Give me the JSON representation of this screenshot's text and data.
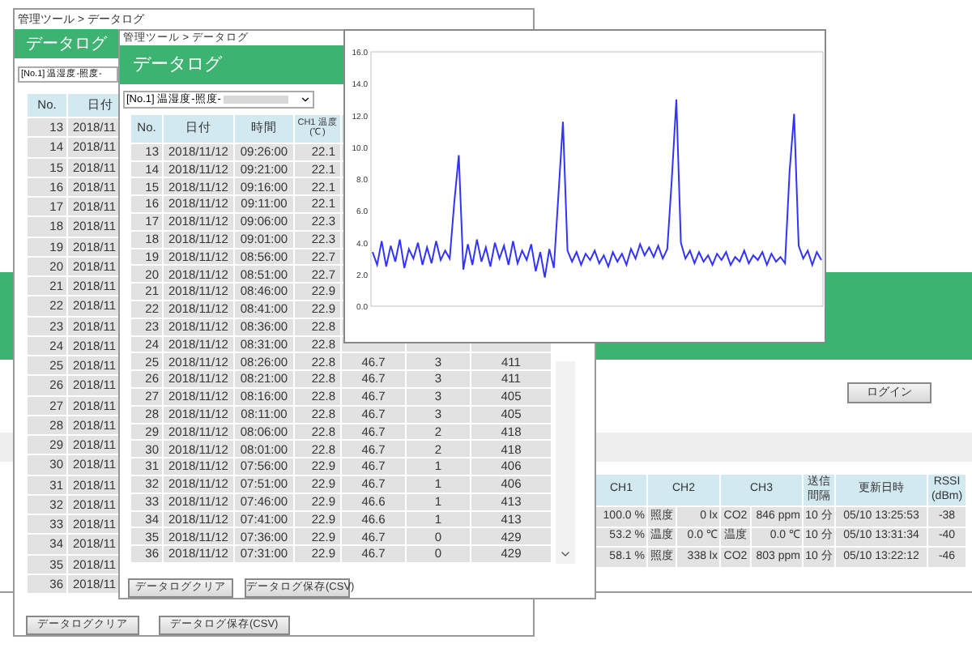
{
  "back_window": {
    "login_button": "ログイン",
    "device_table": {
      "columns": [
        "CH1",
        "CH2",
        "CH3",
        "送信間隔",
        "更新日時",
        "RSSI (dBm)"
      ],
      "rows": [
        {
          "ch1_value": "100.0 %",
          "ch2_label": "照度",
          "ch2_value": "0 lx",
          "ch3_label": "CO2",
          "ch3_value": "846 ppm",
          "interval": "10 分",
          "updated": "05/10 13:25:53",
          "rssi": "-38"
        },
        {
          "ch1_value": "53.2 %",
          "ch2_label": "温度",
          "ch2_value": "0.0 ℃",
          "ch3_label": "温度",
          "ch3_value": "0.0 ℃",
          "interval": "10 分",
          "updated": "05/10 13:31:34",
          "rssi": "-40"
        },
        {
          "ch1_value": "58.1 %",
          "ch2_label": "照度",
          "ch2_value": "338 lx",
          "ch3_label": "CO2",
          "ch3_value": "803 ppm",
          "interval": "10 分",
          "updated": "05/10 13:22:12",
          "rssi": "-46"
        }
      ]
    }
  },
  "window_a": {
    "breadcrumb": "管理ツール > データログ",
    "title": "データログ",
    "device_select": "[No.1] 温湿度-照度-",
    "columns": [
      "No.",
      "日付"
    ],
    "rows": [
      {
        "no": "13",
        "date": "2018/11"
      },
      {
        "no": "14",
        "date": "2018/11"
      },
      {
        "no": "15",
        "date": "2018/11"
      },
      {
        "no": "16",
        "date": "2018/11"
      },
      {
        "no": "17",
        "date": "2018/11"
      },
      {
        "no": "18",
        "date": "2018/11"
      },
      {
        "no": "19",
        "date": "2018/11"
      },
      {
        "no": "20",
        "date": "2018/11"
      },
      {
        "no": "21",
        "date": "2018/11"
      },
      {
        "no": "22",
        "date": "2018/11"
      },
      {
        "no": "23",
        "date": "2018/11"
      },
      {
        "no": "24",
        "date": "2018/11"
      },
      {
        "no": "25",
        "date": "2018/11"
      },
      {
        "no": "26",
        "date": "2018/11"
      },
      {
        "no": "27",
        "date": "2018/11"
      },
      {
        "no": "28",
        "date": "2018/11"
      },
      {
        "no": "29",
        "date": "2018/11"
      },
      {
        "no": "30",
        "date": "2018/11"
      },
      {
        "no": "31",
        "date": "2018/11"
      },
      {
        "no": "32",
        "date": "2018/11"
      },
      {
        "no": "33",
        "date": "2018/11"
      },
      {
        "no": "34",
        "date": "2018/11"
      },
      {
        "no": "35",
        "date": "2018/11"
      },
      {
        "no": "36",
        "date": "2018/11"
      }
    ],
    "buttons": [
      "データログクリア",
      "データログ保存(CSV)"
    ]
  },
  "window_b": {
    "breadcrumb": "管理ツール > データログ",
    "title": "データログ",
    "device_select": "[No.1] 温湿度-照度-",
    "columns": [
      "No.",
      "日付",
      "時間",
      "CH1 温度 (℃)"
    ],
    "rows": [
      {
        "no": "13",
        "date": "2018/11/12",
        "time": "09:26:00",
        "temp": "22.1"
      },
      {
        "no": "14",
        "date": "2018/11/12",
        "time": "09:21:00",
        "temp": "22.1"
      },
      {
        "no": "15",
        "date": "2018/11/12",
        "time": "09:16:00",
        "temp": "22.1"
      },
      {
        "no": "16",
        "date": "2018/11/12",
        "time": "09:11:00",
        "temp": "22.1"
      },
      {
        "no": "17",
        "date": "2018/11/12",
        "time": "09:06:00",
        "temp": "22.3"
      },
      {
        "no": "18",
        "date": "2018/11/12",
        "time": "09:01:00",
        "temp": "22.3"
      },
      {
        "no": "19",
        "date": "2018/11/12",
        "time": "08:56:00",
        "temp": "22.7"
      },
      {
        "no": "20",
        "date": "2018/11/12",
        "time": "08:51:00",
        "temp": "22.7"
      },
      {
        "no": "21",
        "date": "2018/11/12",
        "time": "08:46:00",
        "temp": "22.9"
      },
      {
        "no": "22",
        "date": "2018/11/12",
        "time": "08:41:00",
        "temp": "22.9"
      },
      {
        "no": "23",
        "date": "2018/11/12",
        "time": "08:36:00",
        "temp": "22.8"
      },
      {
        "no": "24",
        "date": "2018/11/12",
        "time": "08:31:00",
        "temp": "22.8"
      },
      {
        "no": "25",
        "date": "2018/11/12",
        "time": "08:26:00",
        "temp": "22.8",
        "humidity": "46.7",
        "lux": "3",
        "co2": "411"
      },
      {
        "no": "26",
        "date": "2018/11/12",
        "time": "08:21:00",
        "temp": "22.8",
        "humidity": "46.7",
        "lux": "3",
        "co2": "411"
      },
      {
        "no": "27",
        "date": "2018/11/12",
        "time": "08:16:00",
        "temp": "22.8",
        "humidity": "46.7",
        "lux": "3",
        "co2": "405"
      },
      {
        "no": "28",
        "date": "2018/11/12",
        "time": "08:11:00",
        "temp": "22.8",
        "humidity": "46.7",
        "lux": "3",
        "co2": "405"
      },
      {
        "no": "29",
        "date": "2018/11/12",
        "time": "08:06:00",
        "temp": "22.8",
        "humidity": "46.7",
        "lux": "2",
        "co2": "418"
      },
      {
        "no": "30",
        "date": "2018/11/12",
        "time": "08:01:00",
        "temp": "22.8",
        "humidity": "46.7",
        "lux": "2",
        "co2": "418"
      },
      {
        "no": "31",
        "date": "2018/11/12",
        "time": "07:56:00",
        "temp": "22.9",
        "humidity": "46.7",
        "lux": "1",
        "co2": "406"
      },
      {
        "no": "32",
        "date": "2018/11/12",
        "time": "07:51:00",
        "temp": "22.9",
        "humidity": "46.7",
        "lux": "1",
        "co2": "406"
      },
      {
        "no": "33",
        "date": "2018/11/12",
        "time": "07:46:00",
        "temp": "22.9",
        "humidity": "46.6",
        "lux": "1",
        "co2": "413"
      },
      {
        "no": "34",
        "date": "2018/11/12",
        "time": "07:41:00",
        "temp": "22.9",
        "humidity": "46.6",
        "lux": "1",
        "co2": "413"
      },
      {
        "no": "35",
        "date": "2018/11/12",
        "time": "07:36:00",
        "temp": "22.9",
        "humidity": "46.7",
        "lux": "0",
        "co2": "429"
      },
      {
        "no": "36",
        "date": "2018/11/12",
        "time": "07:31:00",
        "temp": "22.9",
        "humidity": "46.7",
        "lux": "0",
        "co2": "429"
      }
    ],
    "buttons": [
      "データログクリア",
      "データログ保存(CSV)"
    ]
  },
  "chart_window": {
    "chart_data": {
      "type": "line",
      "ylim": [
        0,
        16
      ],
      "yticks": [
        {
          "value": 0,
          "label": "0.0"
        },
        {
          "value": 2,
          "label": "2.0"
        },
        {
          "value": 4,
          "label": "4.0"
        },
        {
          "value": 6,
          "label": "6.0"
        },
        {
          "value": 8,
          "label": "8.0"
        },
        {
          "value": 10,
          "label": "10.0"
        },
        {
          "value": 12,
          "label": "12.0"
        },
        {
          "value": 14,
          "label": "14.0"
        },
        {
          "value": 16,
          "label": "16.0"
        }
      ],
      "series": [
        {
          "color": "#3333ff",
          "values": [
            3.4,
            2.6,
            4.1,
            2.5,
            3.8,
            2.8,
            4.2,
            2.4,
            3.6,
            3.0,
            4.0,
            2.6,
            3.7,
            2.7,
            4.1,
            2.9,
            3.5,
            3.0,
            6.5,
            9.5,
            2.3,
            3.9,
            2.6,
            4.2,
            2.8,
            3.7,
            2.5,
            4.0,
            3.0,
            3.8,
            2.6,
            4.1,
            2.7,
            3.5,
            2.9,
            3.9,
            2.2,
            3.4,
            1.8,
            3.6,
            2.4,
            7.0,
            11.6,
            3.5,
            2.8,
            3.4,
            2.6,
            3.3,
            2.9,
            3.5,
            2.7,
            3.2,
            2.5,
            3.4,
            2.8,
            3.3,
            2.6,
            3.6,
            3.0,
            3.9,
            3.2,
            3.7,
            3.1,
            3.8,
            3.0,
            3.6,
            8.0,
            13.0,
            4.0,
            3.0,
            3.5,
            2.7,
            3.4,
            2.8,
            3.2,
            2.6,
            3.3,
            2.9,
            3.4,
            2.6,
            3.1,
            2.8,
            3.5,
            2.7,
            3.2,
            2.9,
            3.4,
            2.6,
            3.3,
            2.8,
            3.1,
            2.7,
            8.5,
            12.1,
            3.8,
            3.0,
            3.5,
            2.6,
            3.4,
            2.9
          ]
        }
      ]
    }
  }
}
